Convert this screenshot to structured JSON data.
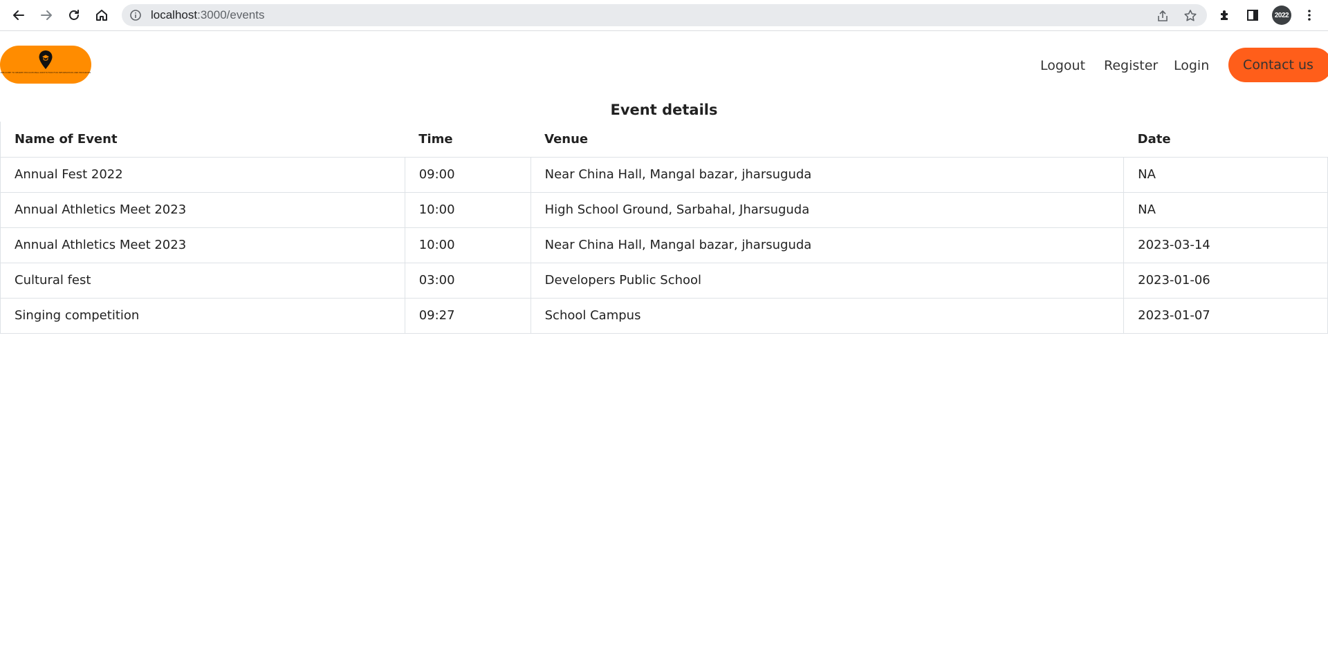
{
  "browser": {
    "url_host": "localhost",
    "url_path": ":3000/events",
    "profile_label": "2022",
    "icons": [
      "back-icon",
      "forward-icon",
      "reload-icon",
      "home-icon",
      "info-icon",
      "share-icon",
      "star-icon",
      "extensions-icon",
      "side-panel-icon",
      "menu-icon"
    ]
  },
  "site": {
    "logo_tagline": "WELCOME TO NEARBY EDUCATIONAL INSTITUTION FOR INFORMATION AND PROGRAMS",
    "nav": {
      "logout": "Logout",
      "register": "Register",
      "login": "Login",
      "contact": "Contact us"
    },
    "colors": {
      "logo_bg": "#ff8c00",
      "contact_bg": "#ff5e1a"
    }
  },
  "events": {
    "title": "Event details",
    "columns": [
      "Name of Event",
      "Time",
      "Venue",
      "Date"
    ],
    "rows": [
      {
        "name": "Annual Fest 2022",
        "time": "09:00",
        "venue": "Near China Hall, Mangal bazar, jharsuguda",
        "date": "NA"
      },
      {
        "name": "Annual Athletics Meet 2023",
        "time": "10:00",
        "venue": "High School Ground, Sarbahal, Jharsuguda",
        "date": "NA"
      },
      {
        "name": "Annual Athletics Meet 2023",
        "time": "10:00",
        "venue": "Near China Hall, Mangal bazar, jharsuguda",
        "date": "2023-03-14"
      },
      {
        "name": "Cultural fest",
        "time": "03:00",
        "venue": "Developers Public School",
        "date": "2023-01-06"
      },
      {
        "name": "Singing competition",
        "time": "09:27",
        "venue": "School Campus",
        "date": "2023-01-07"
      }
    ]
  }
}
